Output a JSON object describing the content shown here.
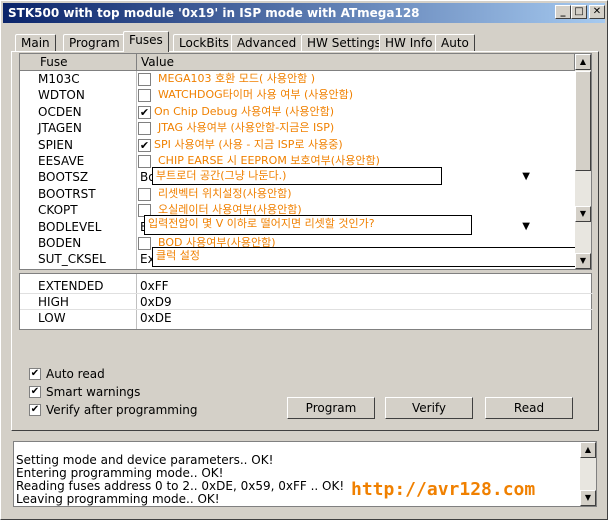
{
  "window": {
    "title": "STK500 with top module '0x19' in ISP mode with ATmega128"
  },
  "titlebar_buttons": {
    "minimize": "_",
    "maximize": "□",
    "close": "✕"
  },
  "tabs": [
    "Main",
    "Program",
    "Fuses",
    "LockBits",
    "Advanced",
    "HW Settings",
    "HW Info",
    "Auto"
  ],
  "grid": {
    "col_fuse": "Fuse",
    "col_value": "Value",
    "rows": [
      {
        "name": "M103C",
        "checked": false,
        "note": "MEGA103 호환 모드( 사용안함 )"
      },
      {
        "name": "WDTON",
        "checked": false,
        "note": "WATCHDOG타이머 사용 여부 (사용안함)"
      },
      {
        "name": "OCDEN",
        "checked": true,
        "note": "On Chip Debug 사용여부 (사용안함)"
      },
      {
        "name": "JTAGEN",
        "checked": false,
        "note": "JTAG 사용여부 (사용안함-지금은 ISP)"
      },
      {
        "name": "SPIEN",
        "checked": true,
        "note": "SPI 사용여부 (사용 - 지금 ISP로 사용중)"
      },
      {
        "name": "EESAVE",
        "checked": false,
        "note": "CHIP EARSE 시 EEPROM 보호여부(사용안함)"
      },
      {
        "name": "BOOTSZ",
        "combo": "Bo",
        "popup": "부트로더 공간(그냥 나둔다.)"
      },
      {
        "name": "BOOTRST",
        "checked": false,
        "note": "리셋벡터 위치설정(사용안함)"
      },
      {
        "name": "CKOPT",
        "checked": false,
        "note": "오실레이터 사용여부(사용안함)"
      },
      {
        "name": "BODLEVEL",
        "combo": "B",
        "popup": "입력전압이 몇 V 이하로 떨어지면 리셋할 것인가?"
      },
      {
        "name": "BODEN",
        "checked": false,
        "note": "BOD 사용여부(사용안함)"
      },
      {
        "name": "SUT_CKSEL",
        "combo": "Ex",
        "popup": "클럭 설정"
      }
    ]
  },
  "fuse_bytes": [
    {
      "name": "EXTENDED",
      "value": "0xFF"
    },
    {
      "name": "HIGH",
      "value": "0xD9"
    },
    {
      "name": "LOW",
      "value": "0xDE"
    }
  ],
  "options": [
    {
      "label": "Auto read",
      "checked": true
    },
    {
      "label": "Smart warnings",
      "checked": true
    },
    {
      "label": "Verify after programming",
      "checked": true
    }
  ],
  "buttons": {
    "program": "Program",
    "verify": "Verify",
    "read": "Read"
  },
  "log": [
    "Setting mode and device parameters.. OK!",
    "Entering programming mode.. OK!",
    "Reading fuses address 0 to 2.. 0xDE, 0x59, 0xFF .. OK!",
    "Leaving programming mode.. OK!"
  ],
  "watermark": "http://avr128.com",
  "glyphs": {
    "check": "✔",
    "up": "▲",
    "down": "▼"
  },
  "colors": {
    "annotation": "#f08000",
    "title_start": "#0a246a"
  }
}
